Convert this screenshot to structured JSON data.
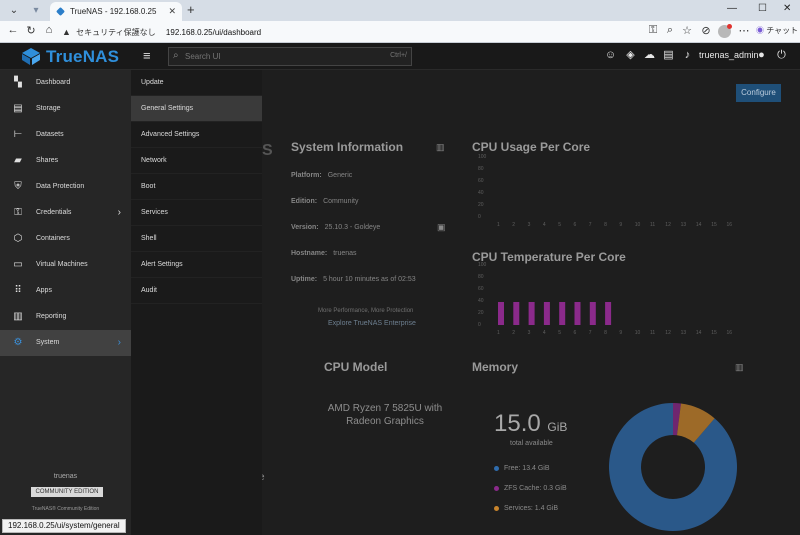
{
  "browser": {
    "tab_title": "TrueNAS - 192.168.0.25",
    "security_label": "セキュリティ保護なし",
    "url": "192.168.0.25/ui/dashboard",
    "chat_label": "チャット"
  },
  "app": {
    "logo_text": "TrueNAS",
    "search_placeholder": "Search UI",
    "search_shortcut": "Ctrl+/",
    "username": "truenas_admin",
    "accent_color": "#2f8fdb"
  },
  "sidebar": {
    "items": [
      {
        "label": "Dashboard",
        "icon": "dashboard-icon"
      },
      {
        "label": "Storage",
        "icon": "storage-icon"
      },
      {
        "label": "Datasets",
        "icon": "datasets-icon"
      },
      {
        "label": "Shares",
        "icon": "shares-icon"
      },
      {
        "label": "Data Protection",
        "icon": "shield-icon"
      },
      {
        "label": "Credentials",
        "icon": "key-icon"
      },
      {
        "label": "Containers",
        "icon": "box-icon"
      },
      {
        "label": "Virtual Machines",
        "icon": "monitor-icon"
      },
      {
        "label": "Apps",
        "icon": "apps-grid-icon"
      },
      {
        "label": "Reporting",
        "icon": "chart-icon"
      },
      {
        "label": "System",
        "icon": "gear-icon"
      }
    ],
    "footer_name": "truenas",
    "edition": "COMMUNITY EDITION",
    "copyright": "TrueNAS® Community Edition"
  },
  "submenu": {
    "items": [
      "Update",
      "General Settings",
      "Advanced Settings",
      "Network",
      "Boot",
      "Services",
      "Shell",
      "Alert Settings",
      "Audit"
    ]
  },
  "dashboard": {
    "configure_label": "Configure",
    "system_info": {
      "title": "System Information",
      "platform_label": "Platform:",
      "platform": "Generic",
      "edition_label": "Edition:",
      "edition": "Community",
      "version_label": "Version:",
      "version": "25.10.3 - Goldeye",
      "hostname_label": "Hostname:",
      "hostname": "truenas",
      "uptime_label": "Uptime:",
      "uptime": "5 hour 10 minutes as of 02:53",
      "promo_line": "More Performance, More Protection",
      "promo_link": "Explore TrueNAS Enterprise"
    },
    "cpu_usage": {
      "title": "CPU Usage Per Core",
      "y_ticks": [
        "100",
        "80",
        "60",
        "40",
        "20",
        "0"
      ],
      "x_ticks": [
        "1",
        "2",
        "3",
        "4",
        "5",
        "6",
        "7",
        "8",
        "9",
        "10",
        "11",
        "12",
        "13",
        "14",
        "15",
        "16"
      ]
    },
    "cpu_temp": {
      "title": "CPU Temperature Per Core",
      "y_ticks": [
        "100",
        "80",
        "60",
        "40",
        "20",
        "0"
      ],
      "x_ticks": [
        "1",
        "2",
        "3",
        "4",
        "5",
        "6",
        "7",
        "8",
        "9",
        "10",
        "11",
        "12",
        "13",
        "14",
        "15",
        "16"
      ],
      "bar_color": "#8b2a8b"
    },
    "cpu_model": {
      "title": "CPU Model",
      "model": "AMD Ryzen 7 5825U with Radeon Graphics"
    },
    "memory": {
      "title": "Memory",
      "total_value": "15.0",
      "total_unit": "GiB",
      "total_label": "total available",
      "legend": [
        {
          "label": "Free:",
          "value": "13.4 GiB",
          "color": "#2f6cad"
        },
        {
          "label": "ZFS Cache:",
          "value": "0.3 GiB",
          "color": "#8b2a8b"
        },
        {
          "label": "Services:",
          "value": "1.4 GiB",
          "color": "#c8842c"
        }
      ]
    }
  },
  "status_bar": {
    "text": "192.168.0.25/ui/system/general"
  }
}
